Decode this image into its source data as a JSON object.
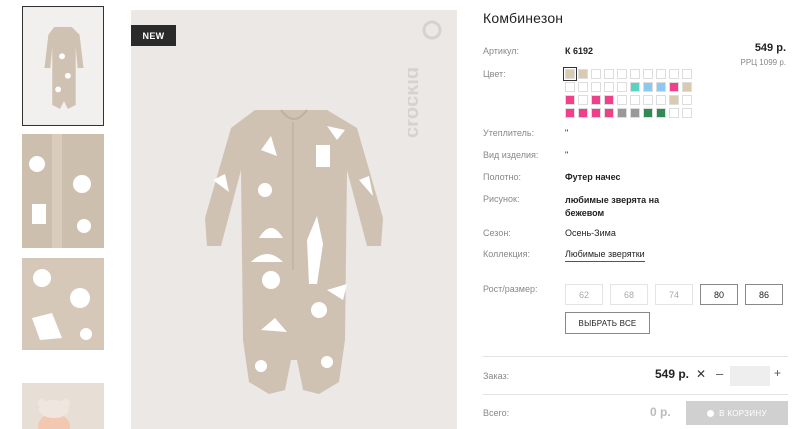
{
  "gallery": {
    "badge": "NEW",
    "brand_logo": "crockid-logo",
    "thumbnails": [
      "onesie-front",
      "fabric-closeup-1",
      "fabric-closeup-2",
      "baby-photo"
    ]
  },
  "product": {
    "title": "Комбинезон",
    "price": "549 р.",
    "rrc": "РРЦ 1099 р.",
    "attributes": [
      {
        "label": "Артикул:",
        "value": "К 6192"
      },
      {
        "label": "Цвет:",
        "value": ""
      },
      {
        "label": "Утеплитель:",
        "value": "\""
      },
      {
        "label": "Вид изделия:",
        "value": "\""
      },
      {
        "label": "Полотно:",
        "value": "Футер начес"
      },
      {
        "label": "Рисунок:",
        "value": "любимые зверята на бежевом"
      },
      {
        "label": "Сезон:",
        "value": "Осень-Зима"
      },
      {
        "label": "Коллекция:",
        "value": "Любимые зверятки"
      }
    ],
    "colors": [
      "#d8cbb2",
      "#d8cbb2",
      "#ffffff",
      "#ffffff",
      "#ffffff",
      "#ffffff",
      "#ffffff",
      "#ffffff",
      "#ffffff",
      "#ffffff",
      "#ffffff",
      "#ffffff",
      "#ffffff",
      "#ffffff",
      "#ffffff",
      "#58d3c0",
      "#8dc8f0",
      "#8dc8f0",
      "#f0408a",
      "#d8cbb2",
      "#f0408a",
      "#ffffff",
      "#f0408a",
      "#f0408a",
      "#ffffff",
      "#ffffff",
      "#ffffff",
      "#ffffff",
      "#d8cbb2",
      "#ffffff",
      "#f0408a",
      "#f0408a",
      "#f0408a",
      "#f0408a",
      "#999999",
      "#999999",
      "#2f8a56",
      "#2f8a56",
      "#ffffff",
      "#ffffff"
    ],
    "size_label": "Рост/размер:",
    "sizes": [
      {
        "label": "62",
        "available": false
      },
      {
        "label": "68",
        "available": false
      },
      {
        "label": "74",
        "available": false
      },
      {
        "label": "80",
        "available": true
      },
      {
        "label": "86",
        "available": true
      }
    ],
    "select_all": "ВЫБРАТЬ ВСЕ"
  },
  "order": {
    "label": "Заказ:",
    "price": "549 р.",
    "remove": "✕",
    "minus": "–",
    "plus": "+",
    "qty": ""
  },
  "total": {
    "label": "Всего:",
    "value": "0 р.",
    "cart_button": "В КОРЗИНУ"
  }
}
